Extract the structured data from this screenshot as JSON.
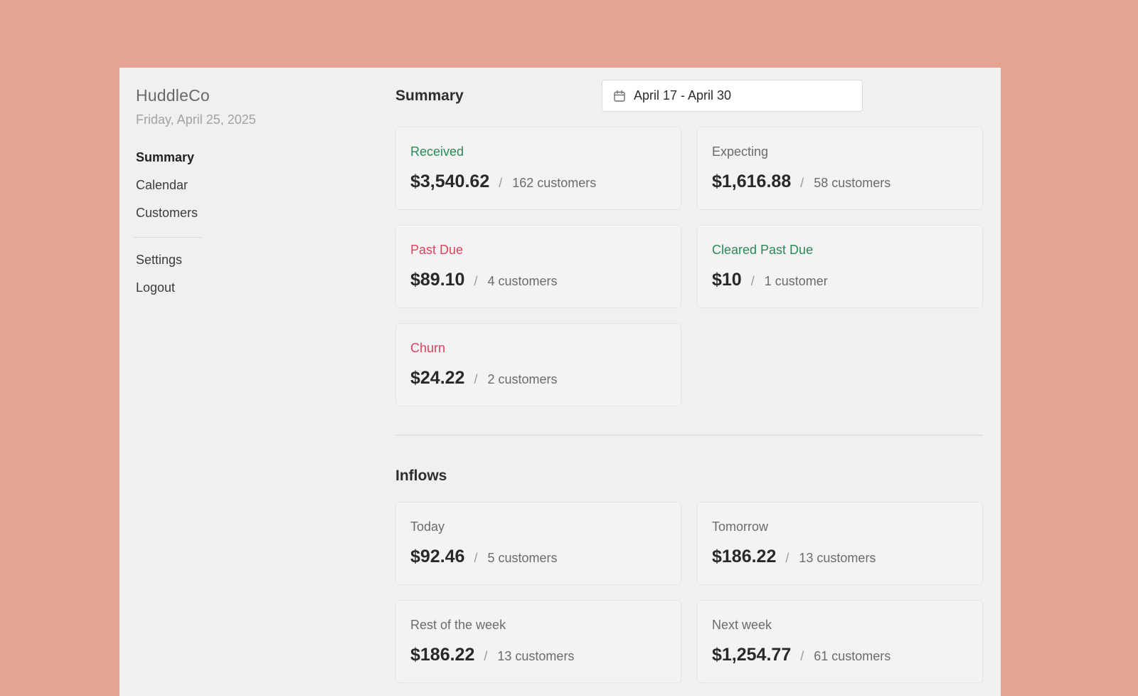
{
  "brand": "HuddleCo",
  "date": "Friday, April 25, 2025",
  "nav": {
    "primary": [
      "Summary",
      "Calendar",
      "Customers"
    ],
    "active": "Summary",
    "secondary": [
      "Settings",
      "Logout"
    ]
  },
  "summary": {
    "title": "Summary",
    "date_range": "April 17 - April 30",
    "cards": [
      {
        "label": "Received",
        "amount": "$3,540.62",
        "count": "162 customers",
        "tone": "green"
      },
      {
        "label": "Expecting",
        "amount": "$1,616.88",
        "count": "58 customers",
        "tone": "neutral"
      },
      {
        "label": "Past Due",
        "amount": "$89.10",
        "count": "4 customers",
        "tone": "red"
      },
      {
        "label": "Cleared Past Due",
        "amount": "$10",
        "count": "1 customer",
        "tone": "green"
      },
      {
        "label": "Churn",
        "amount": "$24.22",
        "count": "2 customers",
        "tone": "red"
      }
    ]
  },
  "inflows": {
    "title": "Inflows",
    "cards": [
      {
        "label": "Today",
        "amount": "$92.46",
        "count": "5 customers"
      },
      {
        "label": "Tomorrow",
        "amount": "$186.22",
        "count": "13 customers"
      },
      {
        "label": "Rest of the week",
        "amount": "$186.22",
        "count": "13 customers"
      },
      {
        "label": "Next week",
        "amount": "$1,254.77",
        "count": "61 customers"
      }
    ]
  },
  "separator": "/",
  "colors": {
    "background": "#e4a491",
    "panel": "#f1f0f1",
    "positive": "#2a8a56",
    "negative": "#e0415b"
  },
  "icons": {
    "date_range": "calendar-icon"
  }
}
